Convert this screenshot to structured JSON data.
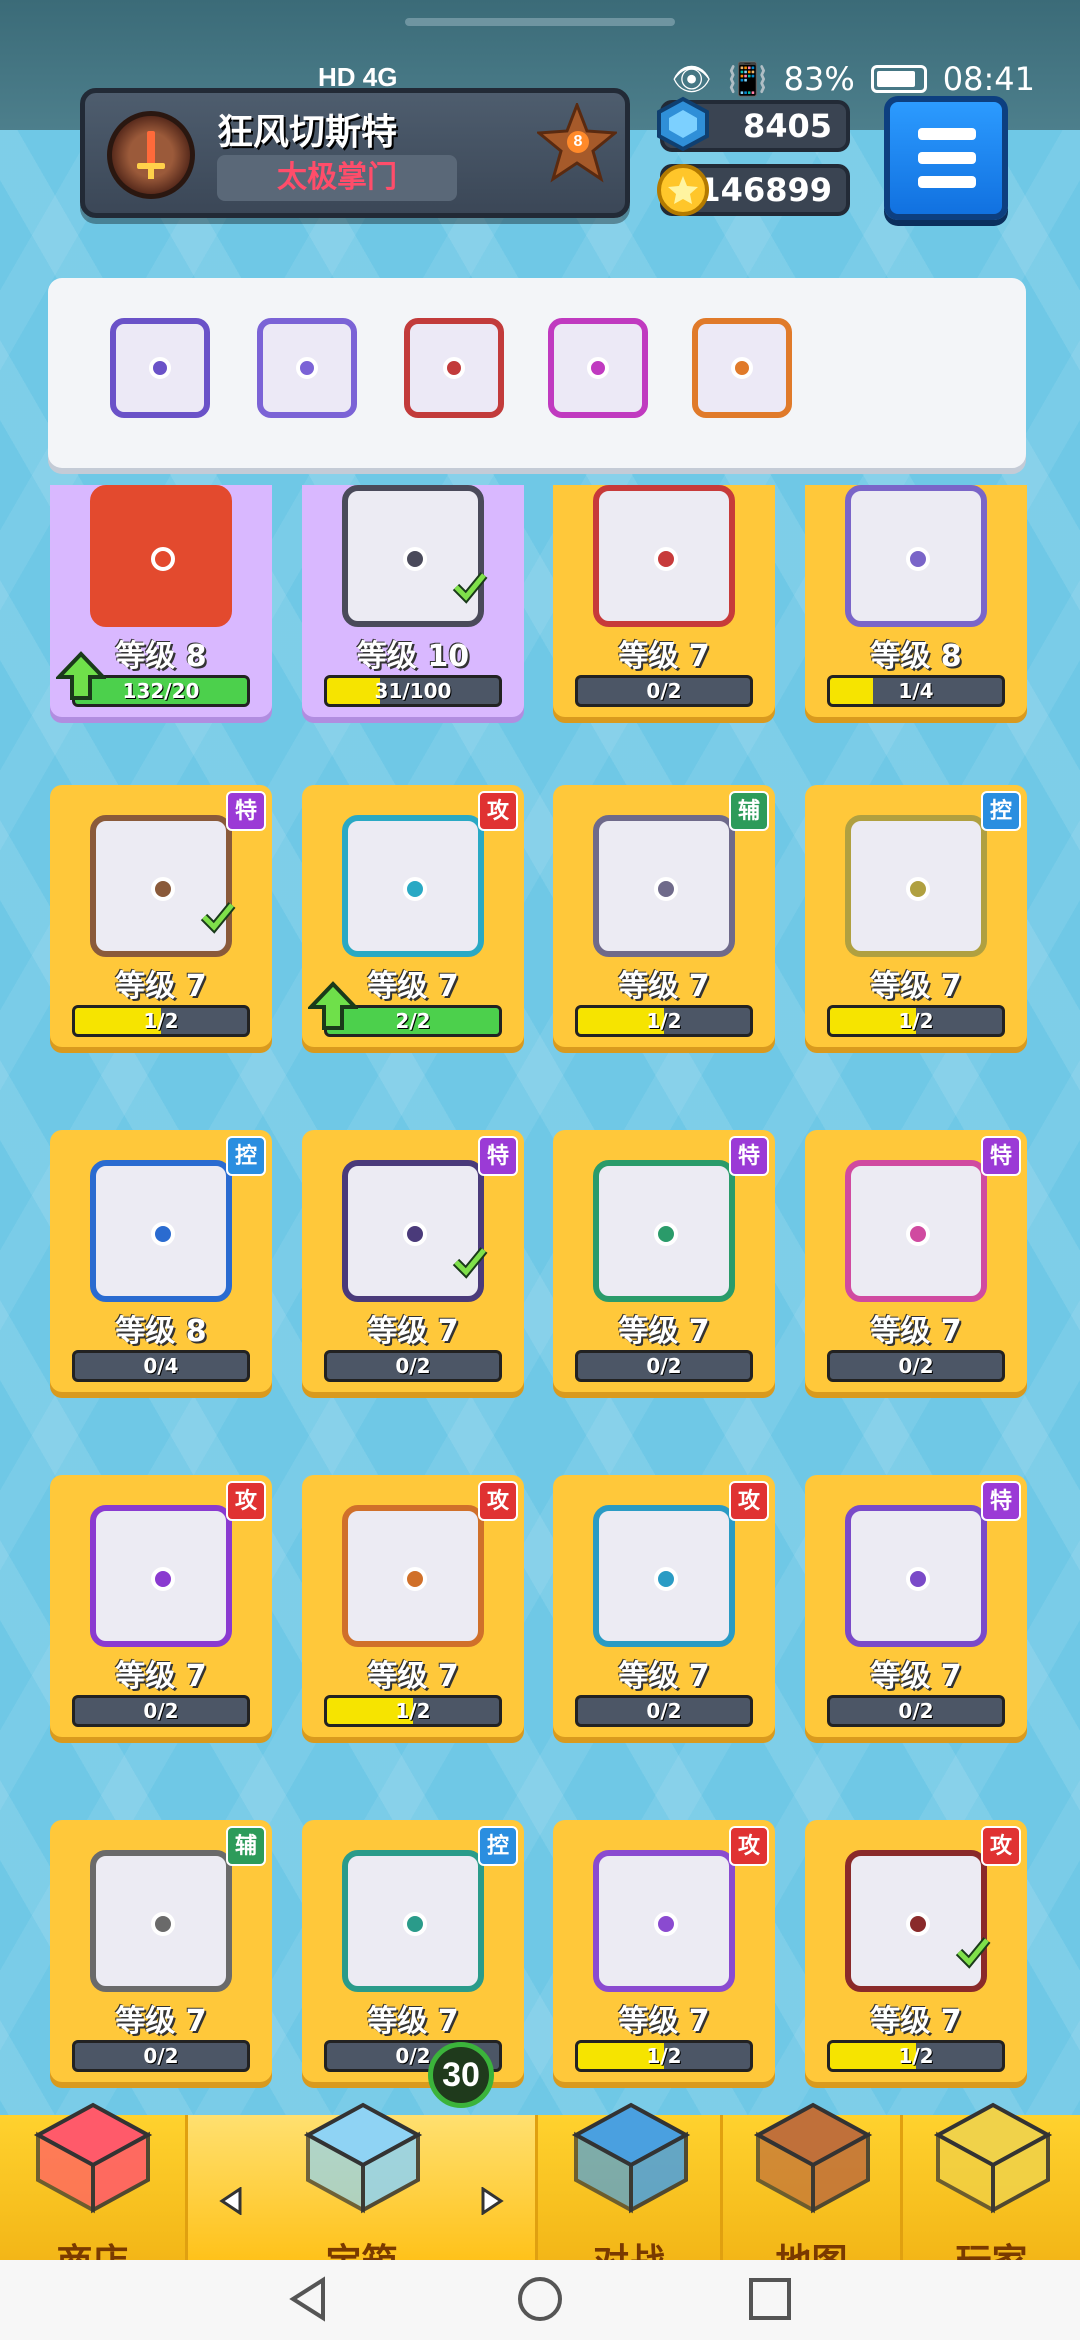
{
  "status_bar": {
    "network": "HD 4G",
    "battery": "83%",
    "time": "08:41"
  },
  "player": {
    "name": "狂风切斯特",
    "guild": "太极掌门",
    "rank": "8"
  },
  "currency": {
    "gems": "8405",
    "coins": "146899"
  },
  "icons": {
    "menu": "hamburger-menu-icon",
    "gem": "blue-gem-icon",
    "coin": "gold-coin-icon"
  },
  "equipped_slots": [
    {
      "name": "slot-1",
      "color": "#6a52c8"
    },
    {
      "name": "slot-2",
      "color": "#7b63d6"
    },
    {
      "name": "slot-3",
      "color": "#c23b3b"
    },
    {
      "name": "slot-4",
      "color": "#c03ac0"
    },
    {
      "name": "slot-5",
      "color": "#e07a2a"
    }
  ],
  "cards": [
    {
      "level": "等级 8",
      "progress": "132/20",
      "fill": 1.0,
      "bar": "green",
      "upgrade": true,
      "top": true,
      "color": "#e34a2e"
    },
    {
      "level": "等级 10",
      "progress": "31/100",
      "fill": 0.31,
      "bar": "yellow",
      "top": true,
      "check": true,
      "color": "#4a4a5a"
    },
    {
      "level": "等级 7",
      "progress": "0/2",
      "fill": 0,
      "bar": "yellow",
      "color": "#c73a3a"
    },
    {
      "level": "等级 8",
      "progress": "1/4",
      "fill": 0.25,
      "bar": "yellow",
      "color": "#7a65c8"
    },
    {
      "level": "等级 7",
      "progress": "1/2",
      "fill": 0.5,
      "bar": "yellow",
      "tag": "特",
      "tag_color": "#9b3ad6",
      "check": true,
      "color": "#8a5a3a"
    },
    {
      "level": "等级 7",
      "progress": "2/2",
      "fill": 1.0,
      "bar": "green",
      "upgrade": true,
      "tag": "攻",
      "tag_color": "#e03232",
      "color": "#2aa9c4"
    },
    {
      "level": "等级 7",
      "progress": "1/2",
      "fill": 0.5,
      "bar": "yellow",
      "tag": "辅",
      "tag_color": "#2d9b5a",
      "color": "#6f6a8a"
    },
    {
      "level": "等级 7",
      "progress": "1/2",
      "fill": 0.5,
      "bar": "yellow",
      "tag": "控",
      "tag_color": "#2a8ee0",
      "color": "#b0a040"
    },
    {
      "level": "等级 8",
      "progress": "0/4",
      "fill": 0,
      "bar": "yellow",
      "tag": "控",
      "tag_color": "#2a8ee0",
      "color": "#2a6bd0"
    },
    {
      "level": "等级 7",
      "progress": "0/2",
      "fill": 0,
      "bar": "yellow",
      "tag": "特",
      "tag_color": "#9b3ad6",
      "check": true,
      "color": "#4a3a7a"
    },
    {
      "level": "等级 7",
      "progress": "0/2",
      "fill": 0,
      "bar": "yellow",
      "tag": "特",
      "tag_color": "#9b3ad6",
      "color": "#2a9b6a"
    },
    {
      "level": "等级 7",
      "progress": "0/2",
      "fill": 0,
      "bar": "yellow",
      "tag": "特",
      "tag_color": "#9b3ad6",
      "color": "#d04aa0"
    },
    {
      "level": "等级 7",
      "progress": "0/2",
      "fill": 0,
      "bar": "yellow",
      "tag": "攻",
      "tag_color": "#e03232",
      "color": "#8a3ad0"
    },
    {
      "level": "等级 7",
      "progress": "1/2",
      "fill": 0.5,
      "bar": "yellow",
      "tag": "攻",
      "tag_color": "#e03232",
      "color": "#d0702a"
    },
    {
      "level": "等级 7",
      "progress": "0/2",
      "fill": 0,
      "bar": "yellow",
      "tag": "攻",
      "tag_color": "#e03232",
      "color": "#2a9bc4"
    },
    {
      "level": "等级 7",
      "progress": "0/2",
      "fill": 0,
      "bar": "yellow",
      "tag": "特",
      "tag_color": "#9b3ad6",
      "color": "#7a4ac8"
    },
    {
      "level": "等级 7",
      "progress": "0/2",
      "fill": 0,
      "bar": "yellow",
      "tag": "辅",
      "tag_color": "#2d9b5a",
      "color": "#6a6a6a"
    },
    {
      "level": "等级 7",
      "progress": "0/2",
      "fill": 0,
      "bar": "yellow",
      "tag": "控",
      "tag_color": "#2a8ee0",
      "color": "#2a9b8a"
    },
    {
      "level": "等级 7",
      "progress": "1/2",
      "fill": 0.5,
      "bar": "yellow",
      "tag": "攻",
      "tag_color": "#e03232",
      "color": "#8a4ad0"
    },
    {
      "level": "等级 7",
      "progress": "1/2",
      "fill": 0.5,
      "bar": "yellow",
      "tag": "攻",
      "tag_color": "#e03232",
      "check": true,
      "color": "#8a2a2a"
    }
  ],
  "bottom_nav": {
    "tabs": [
      {
        "label": "商店",
        "icon": "shop-icon"
      },
      {
        "label": "宝箱",
        "icon": "mystery-box-icon"
      },
      {
        "label": "对战",
        "icon": "battle-icon"
      },
      {
        "label": "地图",
        "icon": "map-icon"
      },
      {
        "label": "玩家",
        "icon": "player-robot-icon"
      }
    ],
    "box_count": "30"
  },
  "system_nav": {
    "back": "back-icon",
    "home": "home-icon",
    "recent": "recents-icon"
  }
}
